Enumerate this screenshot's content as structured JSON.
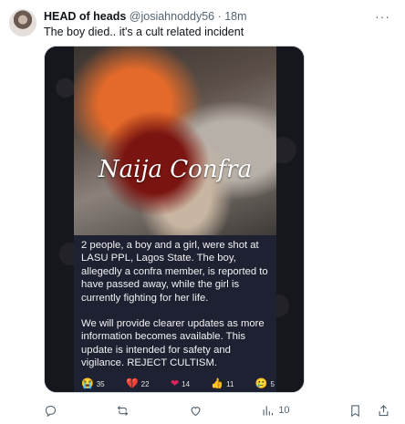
{
  "tweet": {
    "author_name": "HEAD of heads",
    "handle": "@josiahnoddy56",
    "separator": "·",
    "time": "18m",
    "text": "The boy died.. it's a cult related incident",
    "more_label": "···"
  },
  "media": {
    "watermark": "Naija Confra",
    "caption_p1": "2 people, a boy and a girl, were shot at LASU PPL, Lagos State. The boy, allegedly a confra member, is reported to have passed away, while the girl is currently fighting for her life.",
    "caption_p2": "We will provide clearer updates as more information becomes available. This update is intended for safety and vigilance. REJECT CULTISM.",
    "reactions": [
      {
        "emoji": "😭",
        "count": "35"
      },
      {
        "emoji": "💔",
        "count": "22"
      },
      {
        "emoji": "❤",
        "count": "14"
      },
      {
        "emoji": "👍",
        "count": "11"
      },
      {
        "emoji": "🥲",
        "count": "5"
      }
    ]
  },
  "actions": {
    "views_count": "10"
  },
  "icons": {
    "reply": "reply-icon",
    "retweet": "retweet-icon",
    "like": "heart-icon",
    "views": "views-icon",
    "bookmark": "bookmark-icon",
    "share": "share-icon"
  }
}
